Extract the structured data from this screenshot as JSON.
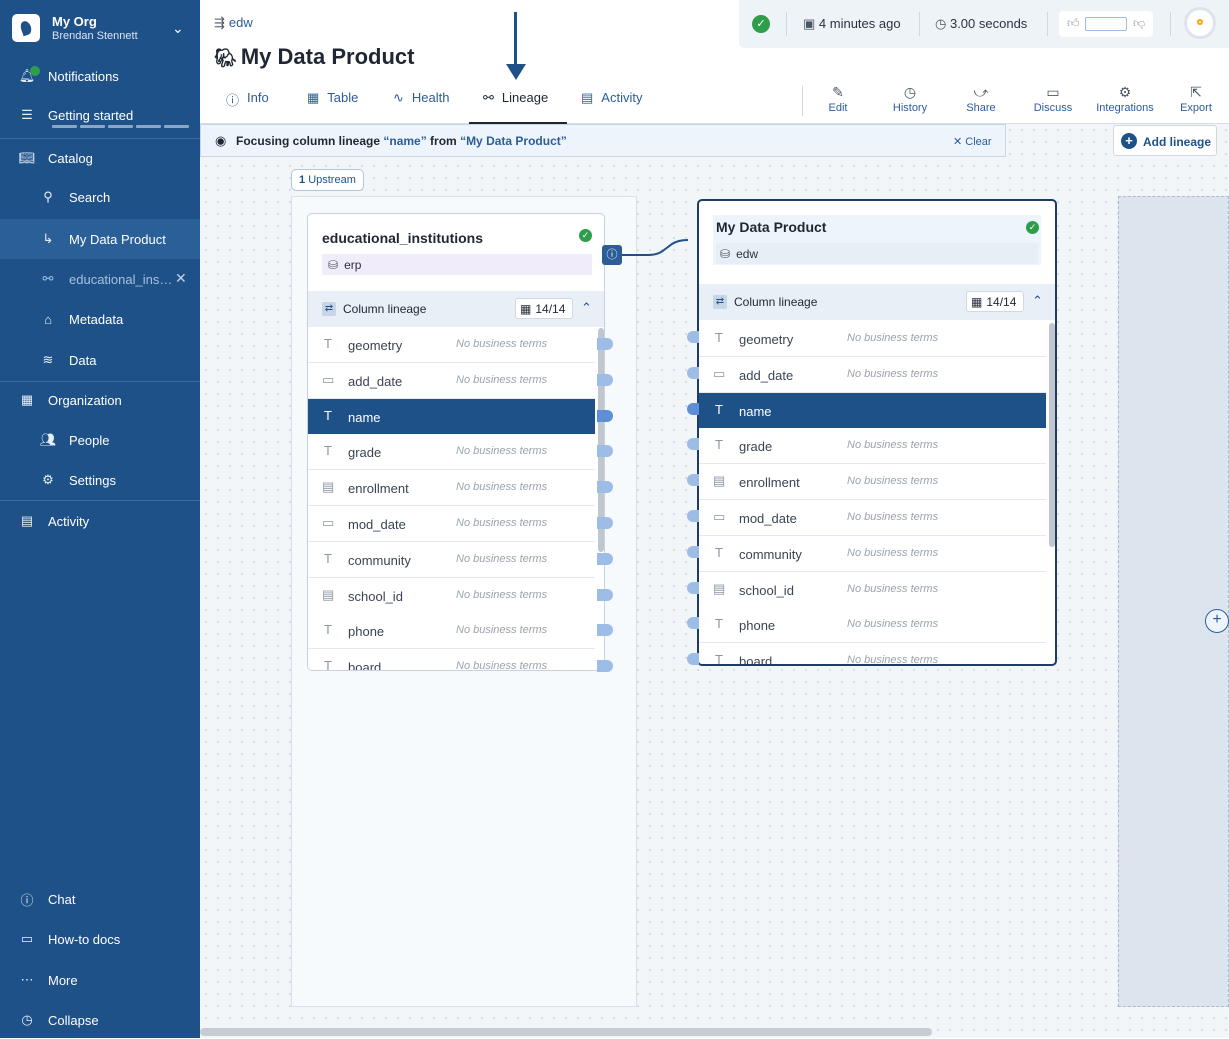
{
  "sidebar": {
    "org_name": "My Org",
    "user_name": "Brendan Stennett",
    "items": [
      {
        "label": "Notifications",
        "icon": "bell-icon"
      },
      {
        "label": "Getting started",
        "icon": "checklist-icon"
      },
      {
        "label": "Catalog",
        "icon": "book-icon"
      },
      {
        "label": "Search",
        "icon": "search-icon"
      },
      {
        "label": "My Data Product",
        "icon": "arrow-turn-icon"
      },
      {
        "label": "educational_ins…",
        "icon": "link-icon"
      },
      {
        "label": "Metadata",
        "icon": "tag-icon"
      },
      {
        "label": "Data",
        "icon": "layers-icon"
      },
      {
        "label": "Organization",
        "icon": "building-icon"
      },
      {
        "label": "People",
        "icon": "people-icon"
      },
      {
        "label": "Settings",
        "icon": "gear-icon"
      },
      {
        "label": "Activity",
        "icon": "chart-icon"
      }
    ],
    "bottom": [
      {
        "label": "Chat",
        "icon": "help-icon"
      },
      {
        "label": "How-to docs",
        "icon": "monitor-icon"
      },
      {
        "label": "More",
        "icon": "ellipsis-icon"
      },
      {
        "label": "Collapse",
        "icon": "collapse-icon"
      }
    ]
  },
  "header": {
    "breadcrumb": "edw",
    "title": "My Data Product",
    "status_time": "4 minutes ago",
    "status_duration": "3.00 seconds"
  },
  "tabs": [
    "Info",
    "Table",
    "Health",
    "Lineage",
    "Activity"
  ],
  "actions": [
    "Edit",
    "History",
    "Share",
    "Discuss",
    "Integrations",
    "Export"
  ],
  "focus": {
    "prefix": "Focusing column lineage ",
    "column": "“name”",
    "middle": " from ",
    "source": "“My Data Product”",
    "clear": "Clear"
  },
  "add_lineage": "Add lineage",
  "upstream_count": "1",
  "upstream_label": "Upstream",
  "left_card": {
    "title": "educational_institutions",
    "source": "erp",
    "lineage_label": "Column lineage",
    "count": "14/14"
  },
  "right_card": {
    "title": "My Data Product",
    "source": "edw",
    "lineage_label": "Column lineage",
    "count": "14/14"
  },
  "no_terms": "No business terms",
  "columns": [
    {
      "name": "geometry",
      "type": "text"
    },
    {
      "name": "add_date",
      "type": "date"
    },
    {
      "name": "name",
      "type": "text"
    },
    {
      "name": "grade",
      "type": "text"
    },
    {
      "name": "enrollment",
      "type": "number"
    },
    {
      "name": "mod_date",
      "type": "date"
    },
    {
      "name": "community",
      "type": "text"
    },
    {
      "name": "school_id",
      "type": "number"
    },
    {
      "name": "phone",
      "type": "text"
    },
    {
      "name": "board",
      "type": "text"
    }
  ],
  "colors": {
    "sidebar": "#1f5189",
    "accent": "#2c5d96",
    "selected_row": "#1f5189",
    "success": "#2e9e4a"
  }
}
